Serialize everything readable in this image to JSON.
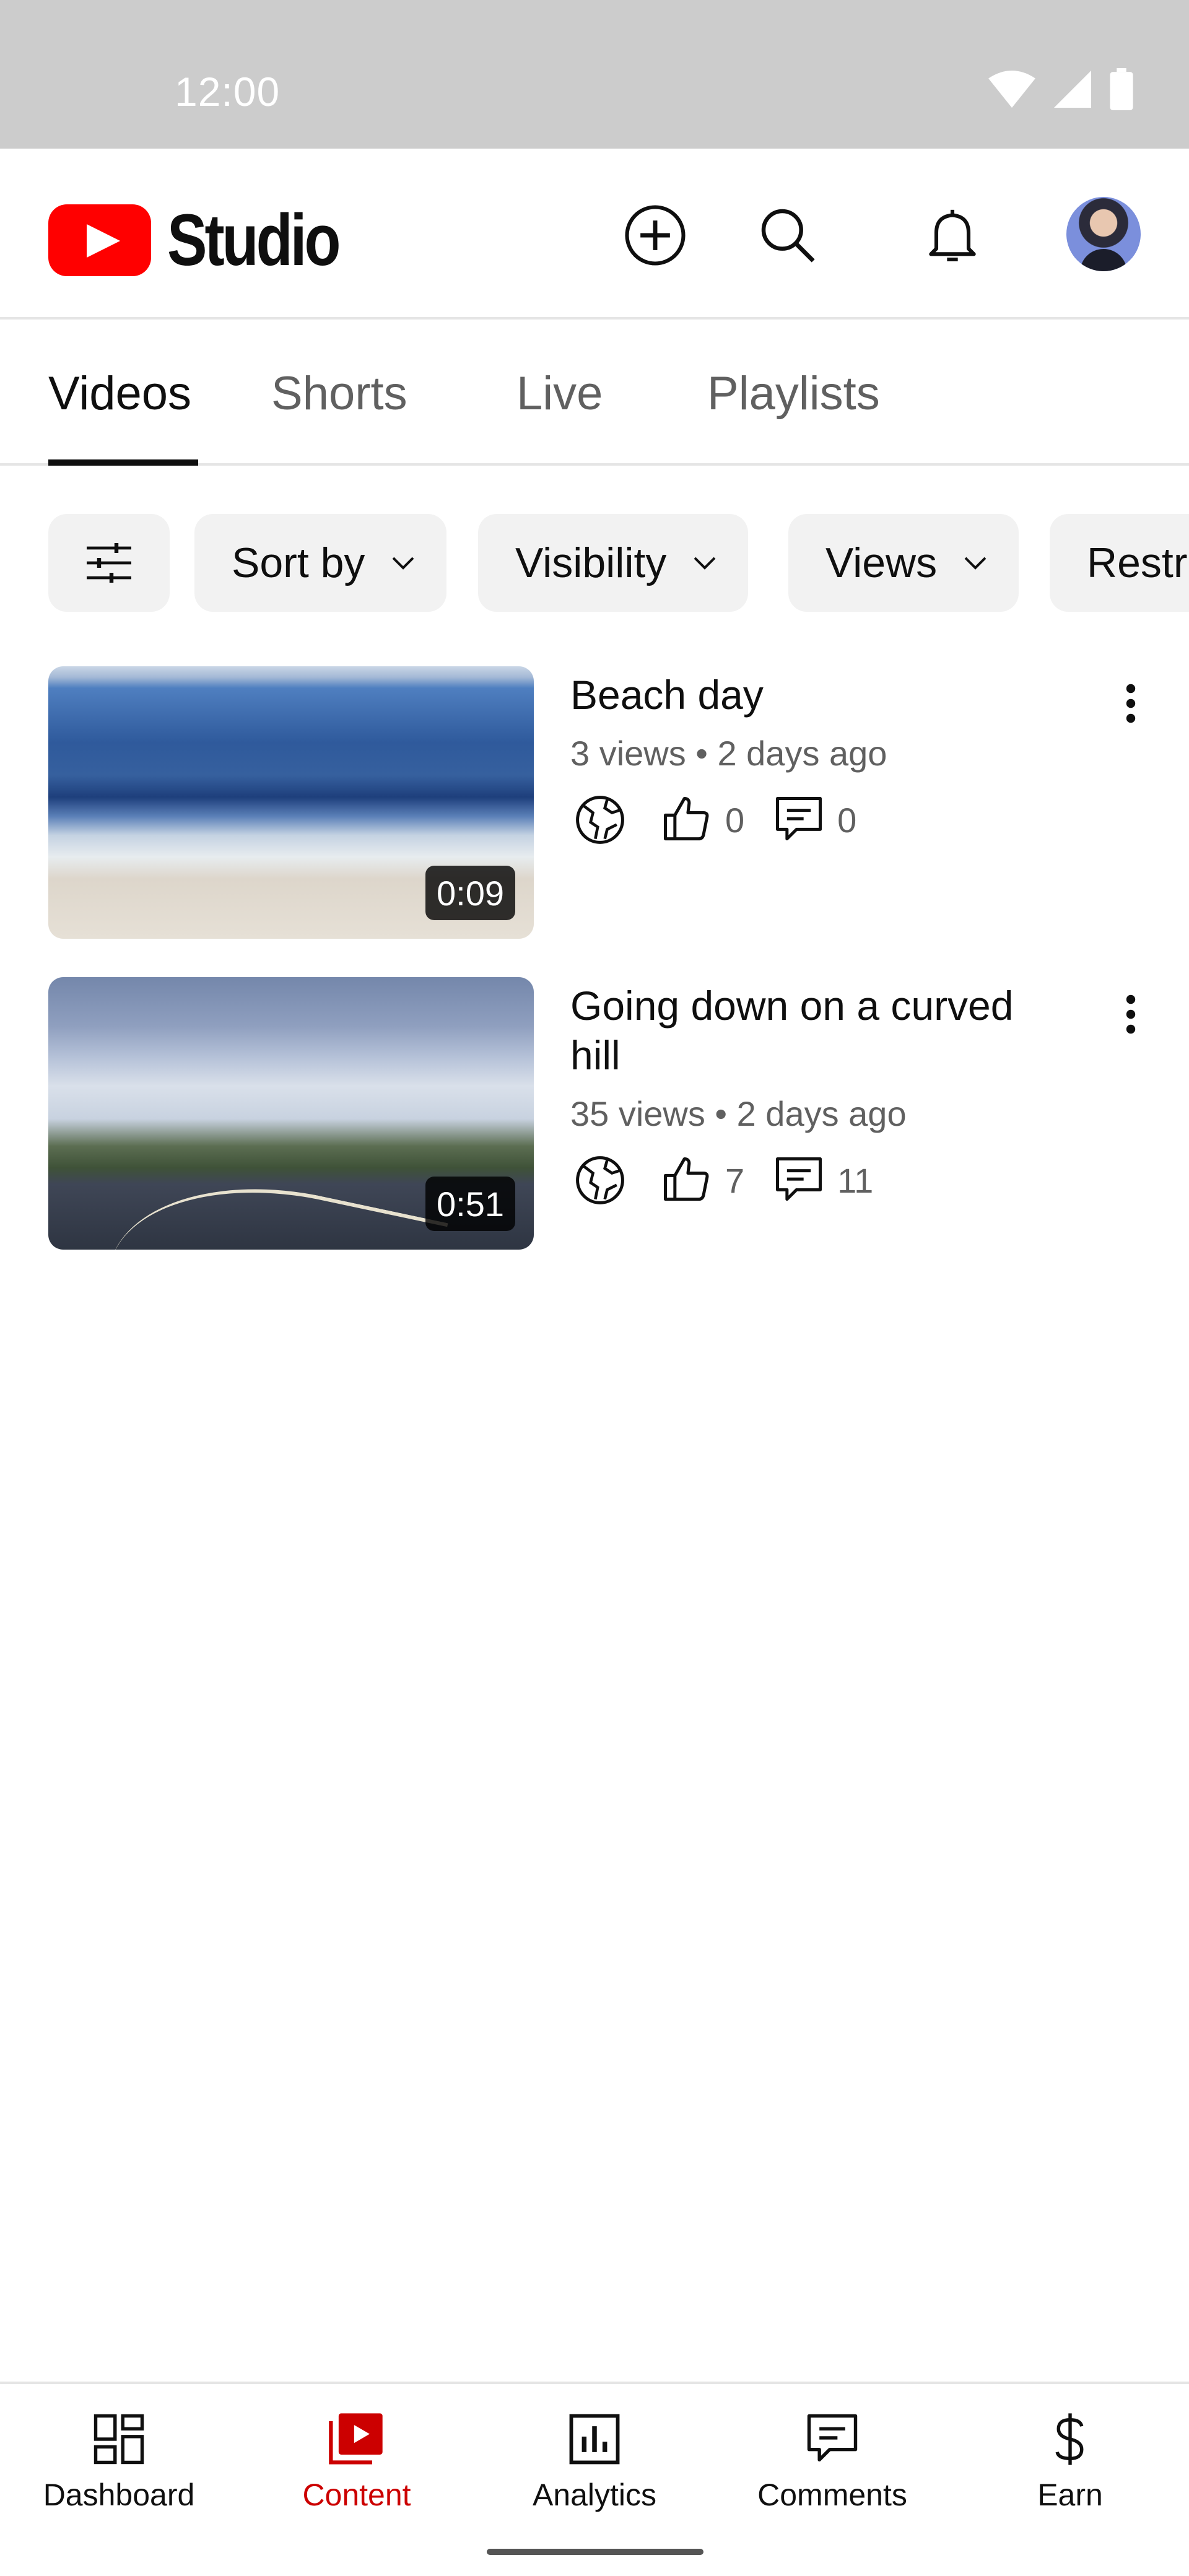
{
  "status_bar": {
    "time": "12:00"
  },
  "header": {
    "logo_text": "Studio"
  },
  "tabs": [
    {
      "label": "Videos",
      "active": true
    },
    {
      "label": "Shorts",
      "active": false
    },
    {
      "label": "Live",
      "active": false
    },
    {
      "label": "Playlists",
      "active": false
    }
  ],
  "chips": [
    {
      "label": "Sort by"
    },
    {
      "label": "Visibility"
    },
    {
      "label": "Views"
    },
    {
      "label": "Restr"
    }
  ],
  "videos": [
    {
      "title": "Beach day",
      "meta": "3 views • 2 days ago",
      "duration": "0:09",
      "likes": "0",
      "comments": "0",
      "visibility_icon": "globe-icon"
    },
    {
      "title": "Going down on a curved hill",
      "meta": "35 views • 2 days ago",
      "duration": "0:51",
      "likes": "7",
      "comments": "11",
      "visibility_icon": "globe-icon"
    }
  ],
  "bottom_nav": [
    {
      "label": "Dashboard",
      "icon": "dashboard-icon",
      "active": false
    },
    {
      "label": "Content",
      "icon": "content-icon",
      "active": true
    },
    {
      "label": "Analytics",
      "icon": "analytics-icon",
      "active": false
    },
    {
      "label": "Comments",
      "icon": "comments-icon",
      "active": false
    },
    {
      "label": "Earn",
      "icon": "dollar-icon",
      "active": false
    }
  ],
  "colors": {
    "brand_red": "#ff0000",
    "active_nav": "#cc0000",
    "chip_bg": "#f2f2f2",
    "status_bar": "#cccccc"
  }
}
